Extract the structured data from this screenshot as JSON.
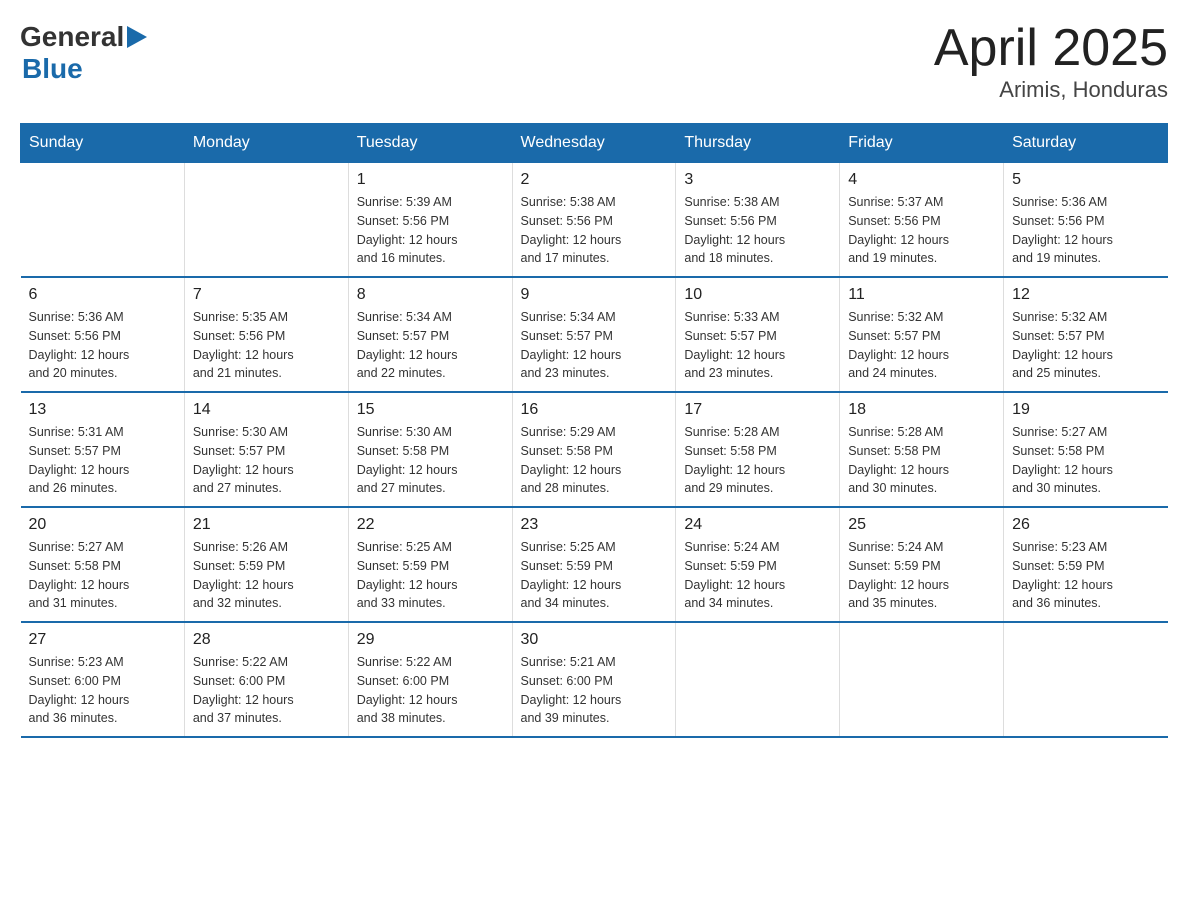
{
  "logo": {
    "general": "General",
    "blue": "Blue"
  },
  "title": "April 2025",
  "subtitle": "Arimis, Honduras",
  "weekdays": [
    "Sunday",
    "Monday",
    "Tuesday",
    "Wednesday",
    "Thursday",
    "Friday",
    "Saturday"
  ],
  "weeks": [
    [
      {
        "day": "",
        "info": ""
      },
      {
        "day": "",
        "info": ""
      },
      {
        "day": "1",
        "info": "Sunrise: 5:39 AM\nSunset: 5:56 PM\nDaylight: 12 hours\nand 16 minutes."
      },
      {
        "day": "2",
        "info": "Sunrise: 5:38 AM\nSunset: 5:56 PM\nDaylight: 12 hours\nand 17 minutes."
      },
      {
        "day": "3",
        "info": "Sunrise: 5:38 AM\nSunset: 5:56 PM\nDaylight: 12 hours\nand 18 minutes."
      },
      {
        "day": "4",
        "info": "Sunrise: 5:37 AM\nSunset: 5:56 PM\nDaylight: 12 hours\nand 19 minutes."
      },
      {
        "day": "5",
        "info": "Sunrise: 5:36 AM\nSunset: 5:56 PM\nDaylight: 12 hours\nand 19 minutes."
      }
    ],
    [
      {
        "day": "6",
        "info": "Sunrise: 5:36 AM\nSunset: 5:56 PM\nDaylight: 12 hours\nand 20 minutes."
      },
      {
        "day": "7",
        "info": "Sunrise: 5:35 AM\nSunset: 5:56 PM\nDaylight: 12 hours\nand 21 minutes."
      },
      {
        "day": "8",
        "info": "Sunrise: 5:34 AM\nSunset: 5:57 PM\nDaylight: 12 hours\nand 22 minutes."
      },
      {
        "day": "9",
        "info": "Sunrise: 5:34 AM\nSunset: 5:57 PM\nDaylight: 12 hours\nand 23 minutes."
      },
      {
        "day": "10",
        "info": "Sunrise: 5:33 AM\nSunset: 5:57 PM\nDaylight: 12 hours\nand 23 minutes."
      },
      {
        "day": "11",
        "info": "Sunrise: 5:32 AM\nSunset: 5:57 PM\nDaylight: 12 hours\nand 24 minutes."
      },
      {
        "day": "12",
        "info": "Sunrise: 5:32 AM\nSunset: 5:57 PM\nDaylight: 12 hours\nand 25 minutes."
      }
    ],
    [
      {
        "day": "13",
        "info": "Sunrise: 5:31 AM\nSunset: 5:57 PM\nDaylight: 12 hours\nand 26 minutes."
      },
      {
        "day": "14",
        "info": "Sunrise: 5:30 AM\nSunset: 5:57 PM\nDaylight: 12 hours\nand 27 minutes."
      },
      {
        "day": "15",
        "info": "Sunrise: 5:30 AM\nSunset: 5:58 PM\nDaylight: 12 hours\nand 27 minutes."
      },
      {
        "day": "16",
        "info": "Sunrise: 5:29 AM\nSunset: 5:58 PM\nDaylight: 12 hours\nand 28 minutes."
      },
      {
        "day": "17",
        "info": "Sunrise: 5:28 AM\nSunset: 5:58 PM\nDaylight: 12 hours\nand 29 minutes."
      },
      {
        "day": "18",
        "info": "Sunrise: 5:28 AM\nSunset: 5:58 PM\nDaylight: 12 hours\nand 30 minutes."
      },
      {
        "day": "19",
        "info": "Sunrise: 5:27 AM\nSunset: 5:58 PM\nDaylight: 12 hours\nand 30 minutes."
      }
    ],
    [
      {
        "day": "20",
        "info": "Sunrise: 5:27 AM\nSunset: 5:58 PM\nDaylight: 12 hours\nand 31 minutes."
      },
      {
        "day": "21",
        "info": "Sunrise: 5:26 AM\nSunset: 5:59 PM\nDaylight: 12 hours\nand 32 minutes."
      },
      {
        "day": "22",
        "info": "Sunrise: 5:25 AM\nSunset: 5:59 PM\nDaylight: 12 hours\nand 33 minutes."
      },
      {
        "day": "23",
        "info": "Sunrise: 5:25 AM\nSunset: 5:59 PM\nDaylight: 12 hours\nand 34 minutes."
      },
      {
        "day": "24",
        "info": "Sunrise: 5:24 AM\nSunset: 5:59 PM\nDaylight: 12 hours\nand 34 minutes."
      },
      {
        "day": "25",
        "info": "Sunrise: 5:24 AM\nSunset: 5:59 PM\nDaylight: 12 hours\nand 35 minutes."
      },
      {
        "day": "26",
        "info": "Sunrise: 5:23 AM\nSunset: 5:59 PM\nDaylight: 12 hours\nand 36 minutes."
      }
    ],
    [
      {
        "day": "27",
        "info": "Sunrise: 5:23 AM\nSunset: 6:00 PM\nDaylight: 12 hours\nand 36 minutes."
      },
      {
        "day": "28",
        "info": "Sunrise: 5:22 AM\nSunset: 6:00 PM\nDaylight: 12 hours\nand 37 minutes."
      },
      {
        "day": "29",
        "info": "Sunrise: 5:22 AM\nSunset: 6:00 PM\nDaylight: 12 hours\nand 38 minutes."
      },
      {
        "day": "30",
        "info": "Sunrise: 5:21 AM\nSunset: 6:00 PM\nDaylight: 12 hours\nand 39 minutes."
      },
      {
        "day": "",
        "info": ""
      },
      {
        "day": "",
        "info": ""
      },
      {
        "day": "",
        "info": ""
      }
    ]
  ]
}
